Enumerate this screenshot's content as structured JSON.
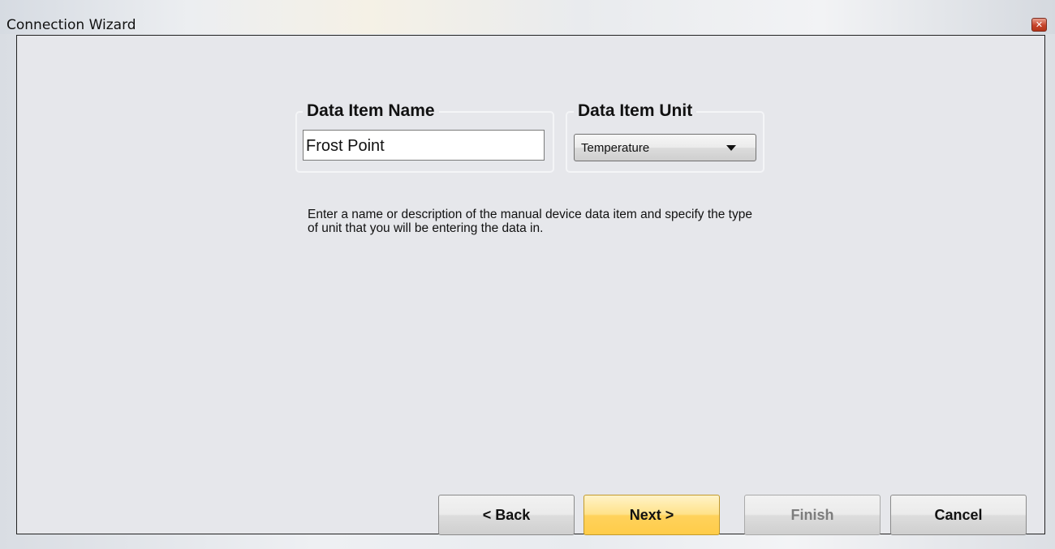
{
  "window": {
    "title": "Connection Wizard",
    "close_glyph": "✕"
  },
  "form": {
    "name_group_label": "Data Item Name",
    "name_value": "Frost Point",
    "unit_group_label": "Data Item Unit",
    "unit_selected": "Temperature",
    "description": "Enter a name or description of the manual device data item and specify the type of unit that you will be entering the data in."
  },
  "buttons": {
    "back": "< Back",
    "next": "Next >",
    "finish": "Finish",
    "cancel": "Cancel"
  },
  "colors": {
    "accent_next_button": "#ffd25c",
    "close_button": "#c6432a"
  },
  "icons": {
    "close": "close-icon",
    "dropdown": "chevron-down-icon"
  }
}
